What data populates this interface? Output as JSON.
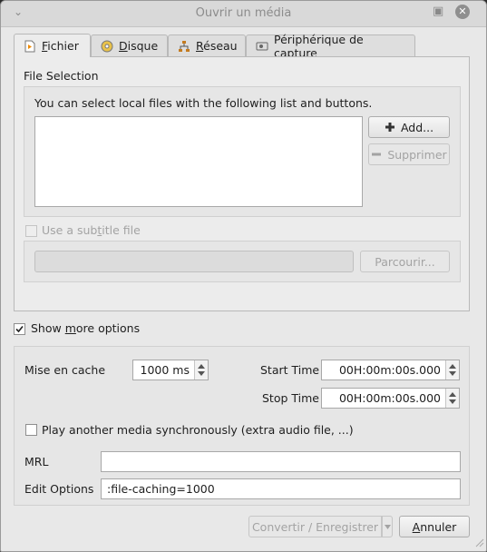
{
  "window": {
    "title": "Ouvrir un média"
  },
  "tabs": [
    {
      "label": "Fichier",
      "mnemonic_before": "",
      "mnemonic": "F",
      "mnemonic_after": "ichier",
      "icon": "file-icon"
    },
    {
      "label": "Disque",
      "mnemonic_before": "",
      "mnemonic": "D",
      "mnemonic_after": "isque",
      "icon": "disc-icon"
    },
    {
      "label": "Réseau",
      "mnemonic_before": "",
      "mnemonic": "R",
      "mnemonic_after": "éseau",
      "icon": "network-icon"
    },
    {
      "label": "Périphérique de capture",
      "mnemonic_before": "Périphérique de cap",
      "mnemonic": "t",
      "mnemonic_after": "ure",
      "icon": "capture-device-icon"
    }
  ],
  "file_selection": {
    "group_title": "File Selection",
    "description": "You can select local files with the following list and buttons.",
    "add_label": "Add...",
    "remove_label": "Supprimer"
  },
  "subtitle": {
    "checkbox_label_before": "Use a sub",
    "checkbox_label_mnemonic": "t",
    "checkbox_label_after": "itle file",
    "browse_label": "Parcourir..."
  },
  "show_more": {
    "label_before": "Show ",
    "label_mnemonic": "m",
    "label_after": "ore options",
    "checked": true
  },
  "options": {
    "cache_label": "Mise en cache",
    "cache_value": "1000 ms",
    "start_time_label": "Start Time",
    "start_time_value": "00H:00m:00s.000",
    "stop_time_label": "Stop Time",
    "stop_time_value": "00H:00m:00s.000",
    "sync_label": "Play another media synchronously (extra audio file, ...)",
    "mrl_label": "MRL",
    "mrl_value": "",
    "edit_options_label": "Edit Options",
    "edit_options_value": ":file-caching=1000"
  },
  "footer": {
    "convert_label": "Convertir / Enregistrer",
    "cancel_before": "",
    "cancel_mnemonic": "A",
    "cancel_after": "nnuler"
  }
}
